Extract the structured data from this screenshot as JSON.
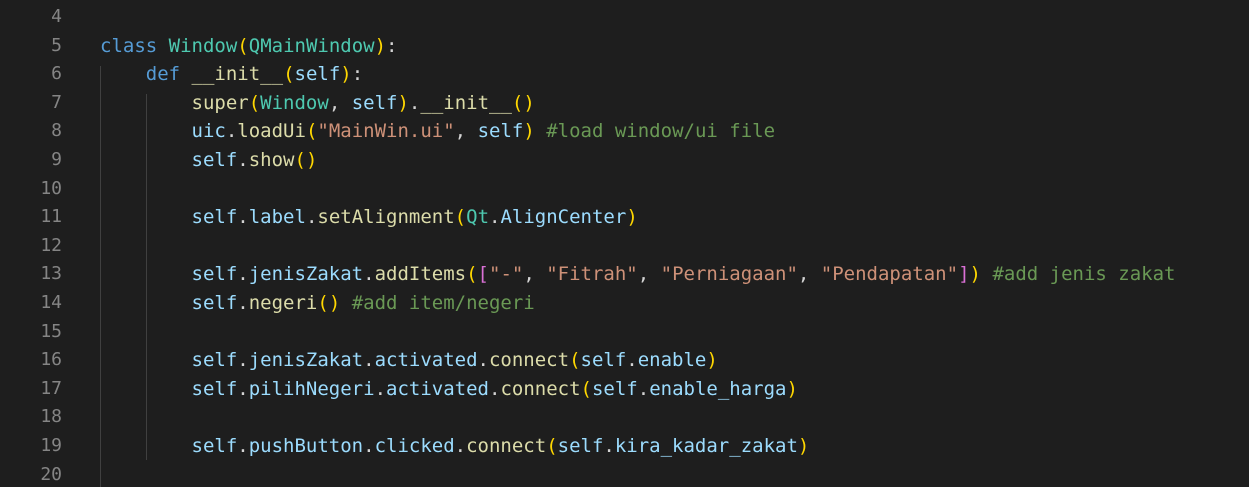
{
  "editor": {
    "theme": {
      "background": "#1e1e1e",
      "line_number": "#858585",
      "keyword": "#569cd6",
      "class": "#4ec9b0",
      "function": "#dcdcaa",
      "variable": "#9cdcfe",
      "string": "#ce9178",
      "comment": "#6a9955",
      "bracket_level1": "#ffd700",
      "bracket_level2": "#da70d6"
    },
    "lines": [
      {
        "number": "4",
        "tokens": []
      },
      {
        "number": "5",
        "tokens": [
          {
            "t": "class",
            "c": "kw"
          },
          {
            "t": " ",
            "c": "pl"
          },
          {
            "t": "Window",
            "c": "cls"
          },
          {
            "t": "(",
            "c": "p1"
          },
          {
            "t": "QMainWindow",
            "c": "cls"
          },
          {
            "t": ")",
            "c": "p1"
          },
          {
            "t": ":",
            "c": "pl"
          }
        ]
      },
      {
        "number": "6",
        "tokens": [
          {
            "t": "    ",
            "c": "pl"
          },
          {
            "t": "def",
            "c": "kw"
          },
          {
            "t": " ",
            "c": "pl"
          },
          {
            "t": "__init__",
            "c": "fn"
          },
          {
            "t": "(",
            "c": "p1"
          },
          {
            "t": "self",
            "c": "var"
          },
          {
            "t": ")",
            "c": "p1"
          },
          {
            "t": ":",
            "c": "pl"
          }
        ]
      },
      {
        "number": "7",
        "tokens": [
          {
            "t": "        ",
            "c": "pl"
          },
          {
            "t": "super",
            "c": "fn"
          },
          {
            "t": "(",
            "c": "p1"
          },
          {
            "t": "Window",
            "c": "cls"
          },
          {
            "t": ", ",
            "c": "pl"
          },
          {
            "t": "self",
            "c": "var"
          },
          {
            "t": ")",
            "c": "p1"
          },
          {
            "t": ".",
            "c": "pl"
          },
          {
            "t": "__init__",
            "c": "fn"
          },
          {
            "t": "()",
            "c": "p1"
          }
        ]
      },
      {
        "number": "8",
        "tokens": [
          {
            "t": "        ",
            "c": "pl"
          },
          {
            "t": "uic",
            "c": "var"
          },
          {
            "t": ".",
            "c": "pl"
          },
          {
            "t": "loadUi",
            "c": "fn"
          },
          {
            "t": "(",
            "c": "p1"
          },
          {
            "t": "\"MainWin.ui\"",
            "c": "str"
          },
          {
            "t": ", ",
            "c": "pl"
          },
          {
            "t": "self",
            "c": "var"
          },
          {
            "t": ")",
            "c": "p1"
          },
          {
            "t": " ",
            "c": "pl"
          },
          {
            "t": "#load window/ui file",
            "c": "cmt"
          }
        ]
      },
      {
        "number": "9",
        "tokens": [
          {
            "t": "        ",
            "c": "pl"
          },
          {
            "t": "self",
            "c": "var"
          },
          {
            "t": ".",
            "c": "pl"
          },
          {
            "t": "show",
            "c": "fn"
          },
          {
            "t": "()",
            "c": "p1"
          }
        ]
      },
      {
        "number": "10",
        "tokens": []
      },
      {
        "number": "11",
        "tokens": [
          {
            "t": "        ",
            "c": "pl"
          },
          {
            "t": "self",
            "c": "var"
          },
          {
            "t": ".",
            "c": "pl"
          },
          {
            "t": "label",
            "c": "var"
          },
          {
            "t": ".",
            "c": "pl"
          },
          {
            "t": "setAlignment",
            "c": "fn"
          },
          {
            "t": "(",
            "c": "p1"
          },
          {
            "t": "Qt",
            "c": "cls"
          },
          {
            "t": ".",
            "c": "pl"
          },
          {
            "t": "AlignCenter",
            "c": "var"
          },
          {
            "t": ")",
            "c": "p1"
          }
        ]
      },
      {
        "number": "12",
        "tokens": []
      },
      {
        "number": "13",
        "tokens": [
          {
            "t": "        ",
            "c": "pl"
          },
          {
            "t": "self",
            "c": "var"
          },
          {
            "t": ".",
            "c": "pl"
          },
          {
            "t": "jenisZakat",
            "c": "var"
          },
          {
            "t": ".",
            "c": "pl"
          },
          {
            "t": "addItems",
            "c": "fn"
          },
          {
            "t": "(",
            "c": "p1"
          },
          {
            "t": "[",
            "c": "p2"
          },
          {
            "t": "\"-\"",
            "c": "str"
          },
          {
            "t": ", ",
            "c": "pl"
          },
          {
            "t": "\"Fitrah\"",
            "c": "str"
          },
          {
            "t": ", ",
            "c": "pl"
          },
          {
            "t": "\"Perniagaan\"",
            "c": "str"
          },
          {
            "t": ", ",
            "c": "pl"
          },
          {
            "t": "\"Pendapatan\"",
            "c": "str"
          },
          {
            "t": "]",
            "c": "p2"
          },
          {
            "t": ")",
            "c": "p1"
          },
          {
            "t": " ",
            "c": "pl"
          },
          {
            "t": "#add jenis zakat",
            "c": "cmt"
          }
        ]
      },
      {
        "number": "14",
        "tokens": [
          {
            "t": "        ",
            "c": "pl"
          },
          {
            "t": "self",
            "c": "var"
          },
          {
            "t": ".",
            "c": "pl"
          },
          {
            "t": "negeri",
            "c": "fn"
          },
          {
            "t": "()",
            "c": "p1"
          },
          {
            "t": " ",
            "c": "pl"
          },
          {
            "t": "#add item/negeri",
            "c": "cmt"
          }
        ]
      },
      {
        "number": "15",
        "tokens": []
      },
      {
        "number": "16",
        "tokens": [
          {
            "t": "        ",
            "c": "pl"
          },
          {
            "t": "self",
            "c": "var"
          },
          {
            "t": ".",
            "c": "pl"
          },
          {
            "t": "jenisZakat",
            "c": "var"
          },
          {
            "t": ".",
            "c": "pl"
          },
          {
            "t": "activated",
            "c": "var"
          },
          {
            "t": ".",
            "c": "pl"
          },
          {
            "t": "connect",
            "c": "fn"
          },
          {
            "t": "(",
            "c": "p1"
          },
          {
            "t": "self",
            "c": "var"
          },
          {
            "t": ".",
            "c": "pl"
          },
          {
            "t": "enable",
            "c": "var"
          },
          {
            "t": ")",
            "c": "p1"
          }
        ]
      },
      {
        "number": "17",
        "tokens": [
          {
            "t": "        ",
            "c": "pl"
          },
          {
            "t": "self",
            "c": "var"
          },
          {
            "t": ".",
            "c": "pl"
          },
          {
            "t": "pilihNegeri",
            "c": "var"
          },
          {
            "t": ".",
            "c": "pl"
          },
          {
            "t": "activated",
            "c": "var"
          },
          {
            "t": ".",
            "c": "pl"
          },
          {
            "t": "connect",
            "c": "fn"
          },
          {
            "t": "(",
            "c": "p1"
          },
          {
            "t": "self",
            "c": "var"
          },
          {
            "t": ".",
            "c": "pl"
          },
          {
            "t": "enable_harga",
            "c": "var"
          },
          {
            "t": ")",
            "c": "p1"
          }
        ]
      },
      {
        "number": "18",
        "tokens": []
      },
      {
        "number": "19",
        "tokens": [
          {
            "t": "        ",
            "c": "pl"
          },
          {
            "t": "self",
            "c": "var"
          },
          {
            "t": ".",
            "c": "pl"
          },
          {
            "t": "pushButton",
            "c": "var"
          },
          {
            "t": ".",
            "c": "pl"
          },
          {
            "t": "clicked",
            "c": "var"
          },
          {
            "t": ".",
            "c": "pl"
          },
          {
            "t": "connect",
            "c": "fn"
          },
          {
            "t": "(",
            "c": "p1"
          },
          {
            "t": "self",
            "c": "var"
          },
          {
            "t": ".",
            "c": "pl"
          },
          {
            "t": "kira_kadar_zakat",
            "c": "var"
          },
          {
            "t": ")",
            "c": "p1"
          }
        ]
      },
      {
        "number": "20",
        "tokens": []
      }
    ]
  }
}
